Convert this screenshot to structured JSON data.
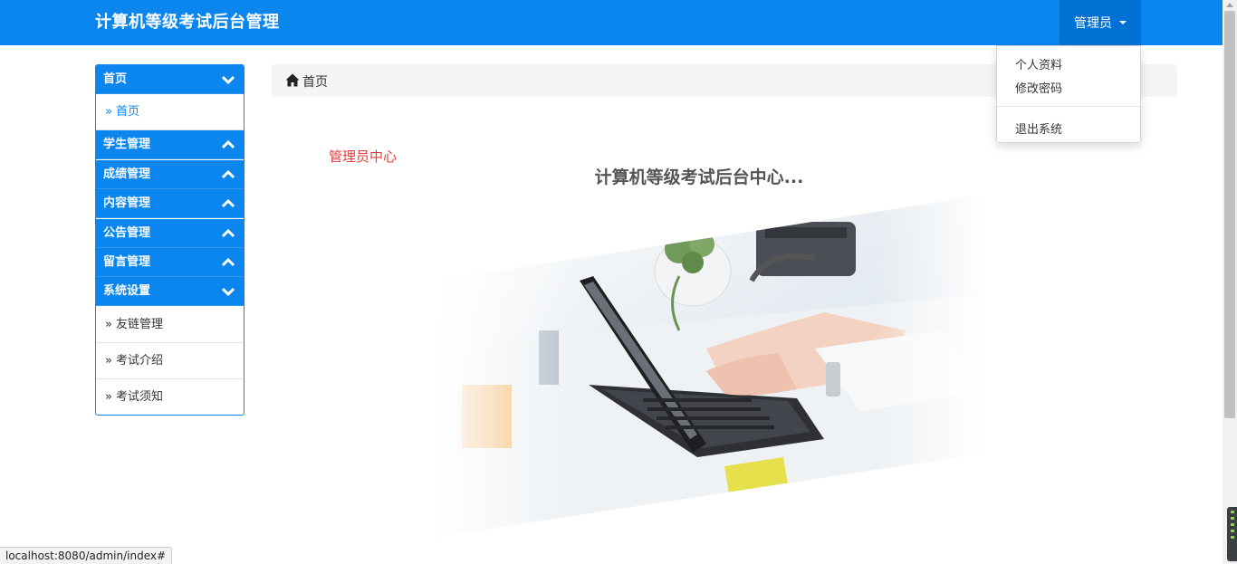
{
  "header": {
    "brand": "计算机等级考试后台管理",
    "user_label": "管理员"
  },
  "user_dropdown": {
    "profile": "个人资料",
    "change_password": "修改密码",
    "logout": "退出系统"
  },
  "sidebar": {
    "sections": [
      {
        "title": "首页",
        "expanded": true,
        "items": [
          "首页"
        ]
      },
      {
        "title": "学生管理",
        "expanded": false
      },
      {
        "title": "成绩管理",
        "expanded": false
      },
      {
        "title": "内容管理",
        "expanded": false
      },
      {
        "title": "公告管理",
        "expanded": false
      },
      {
        "title": "留言管理",
        "expanded": false
      },
      {
        "title": "系统设置",
        "expanded": true,
        "items": [
          "友链管理",
          "考试介绍",
          "考试须知"
        ]
      }
    ],
    "item_prefix": "»"
  },
  "breadcrumb": {
    "home_icon": "home-icon",
    "label": "首页"
  },
  "main": {
    "admin_center": "管理员中心",
    "title": "计算机等级考试后台中心..."
  },
  "status_bar": {
    "url": "localhost:8080/admin/index#"
  },
  "colors": {
    "primary": "#0a86ee",
    "primary_dark": "#0072d6",
    "accent_red": "#e23b3b"
  }
}
